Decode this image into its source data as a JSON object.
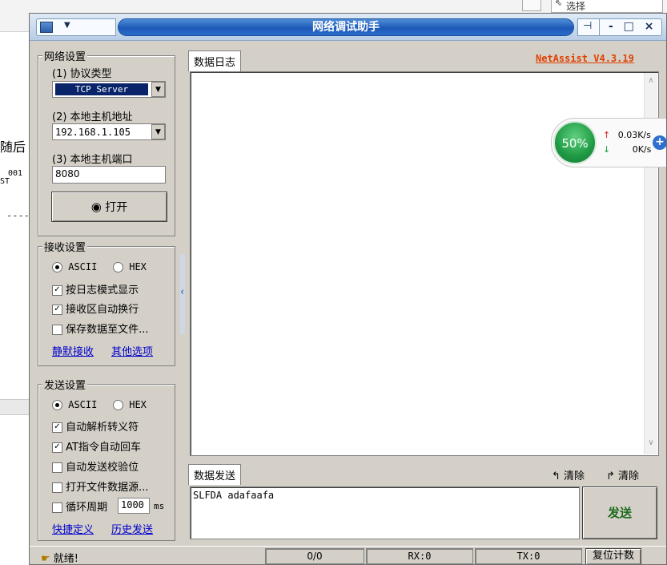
{
  "window": {
    "title": "网络调试助手",
    "controls": "- □ ×"
  },
  "background": {
    "select_label": "选择",
    "text1": "随后",
    "text2_a": "001",
    "text2_b": "ST",
    "dashes": "----"
  },
  "network": {
    "group_title": "网络设置",
    "protocol_label": "(1) 协议类型",
    "protocol_value": "TCP Server",
    "host_label": "(2) 本地主机地址",
    "host_value": "192.168.1.105",
    "port_label": "(3) 本地主机端口",
    "port_value": "8080",
    "open_label": "打开"
  },
  "receive": {
    "group_title": "接收设置",
    "ascii": "ASCII",
    "hex": "HEX",
    "opt1": "按日志模式显示",
    "opt2": "接收区自动换行",
    "opt3": "保存数据至文件...",
    "link1": "静默接收",
    "link2": "其他选项"
  },
  "send": {
    "group_title": "发送设置",
    "ascii": "ASCII",
    "hex": "HEX",
    "opt1": "自动解析转义符",
    "opt2": "AT指令自动回车",
    "opt3": "自动发送校验位",
    "opt4": "打开文件数据源...",
    "opt5": "循环周期",
    "period_value": "1000",
    "period_unit": "ms",
    "link1": "快捷定义",
    "link2": "历史发送"
  },
  "log": {
    "tab_label": "数据日志",
    "version": "NetAssist V4.3.19"
  },
  "send_panel": {
    "tab_label": "数据发送",
    "clear1": "清除",
    "clear2": "清除",
    "text": "SLFDA adafaafa",
    "send_label": "发送"
  },
  "widget": {
    "percent": "50%",
    "up": "0.03K/s",
    "down": "0K/s",
    "plus": "+"
  },
  "status": {
    "ready": "就绪!",
    "count": "0/0",
    "rx": "RX:0",
    "tx": "TX:0",
    "reset": "复位计数"
  },
  "colors": {
    "title_blue": "#1d5ab8",
    "version_orange": "#e04000",
    "send_green": "#1d6a1d",
    "link_blue": "#0000cc"
  }
}
